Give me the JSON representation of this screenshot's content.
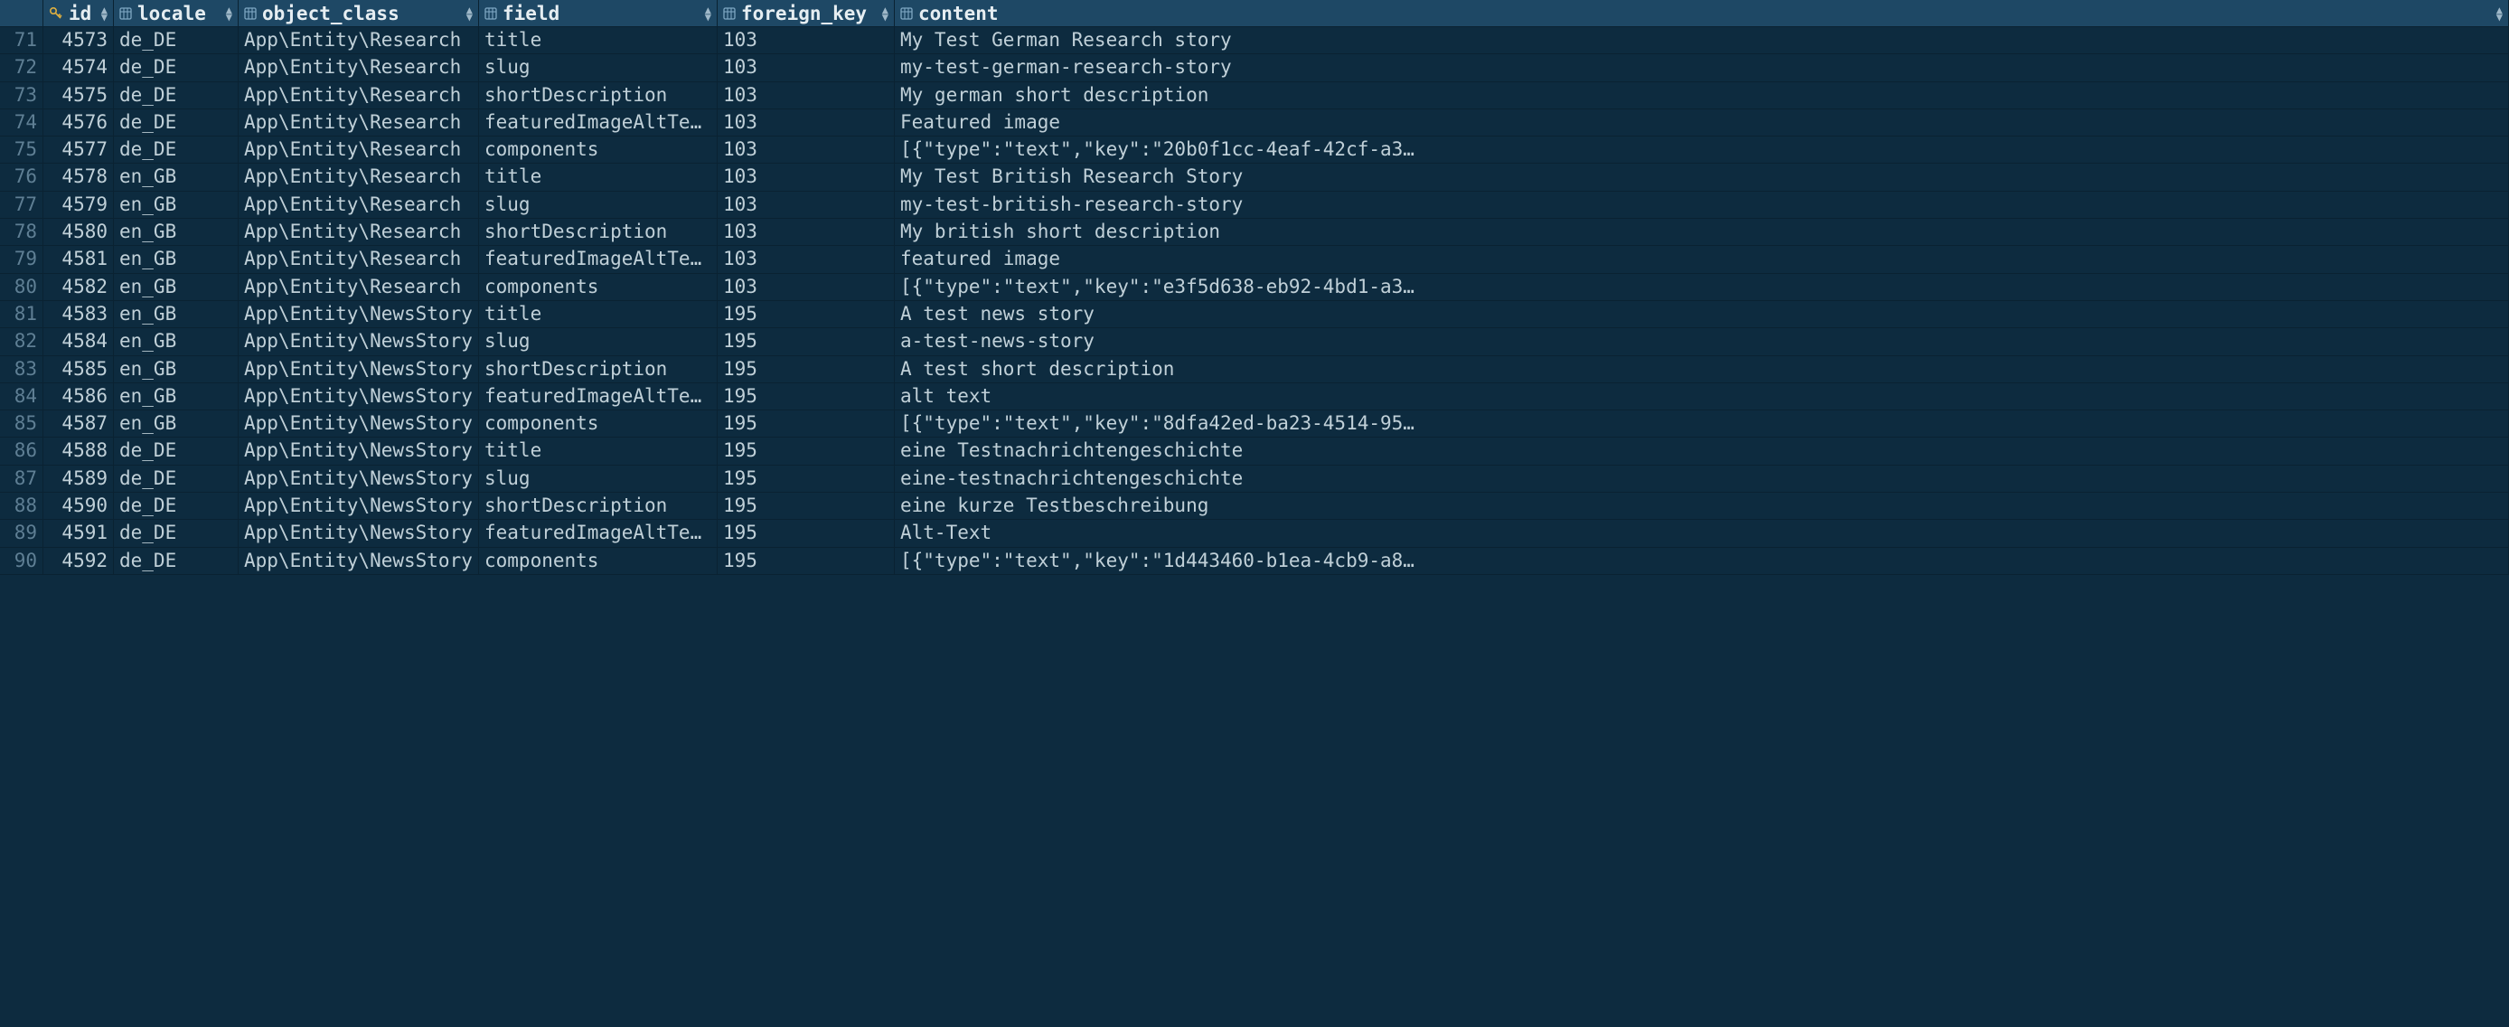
{
  "columns": [
    {
      "name": "id",
      "type": "pk"
    },
    {
      "name": "locale",
      "type": "col"
    },
    {
      "name": "object_class",
      "type": "col"
    },
    {
      "name": "field",
      "type": "col"
    },
    {
      "name": "foreign_key",
      "type": "col"
    },
    {
      "name": "content",
      "type": "col"
    }
  ],
  "rows": [
    {
      "n": 71,
      "id": 4573,
      "locale": "de_DE",
      "object_class": "App\\Entity\\Research",
      "field": "title",
      "foreign_key": 103,
      "content": "My Test German Research story"
    },
    {
      "n": 72,
      "id": 4574,
      "locale": "de_DE",
      "object_class": "App\\Entity\\Research",
      "field": "slug",
      "foreign_key": 103,
      "content": "my-test-german-research-story"
    },
    {
      "n": 73,
      "id": 4575,
      "locale": "de_DE",
      "object_class": "App\\Entity\\Research",
      "field": "shortDescription",
      "foreign_key": 103,
      "content": "My german short description"
    },
    {
      "n": 74,
      "id": 4576,
      "locale": "de_DE",
      "object_class": "App\\Entity\\Research",
      "field": "featuredImageAltText",
      "foreign_key": 103,
      "content": "Featured image"
    },
    {
      "n": 75,
      "id": 4577,
      "locale": "de_DE",
      "object_class": "App\\Entity\\Research",
      "field": "components",
      "foreign_key": 103,
      "content": "[{\"type\":\"text\",\"key\":\"20b0f1cc-4eaf-42cf-a3…"
    },
    {
      "n": 76,
      "id": 4578,
      "locale": "en_GB",
      "object_class": "App\\Entity\\Research",
      "field": "title",
      "foreign_key": 103,
      "content": "My Test British Research Story"
    },
    {
      "n": 77,
      "id": 4579,
      "locale": "en_GB",
      "object_class": "App\\Entity\\Research",
      "field": "slug",
      "foreign_key": 103,
      "content": "my-test-british-research-story"
    },
    {
      "n": 78,
      "id": 4580,
      "locale": "en_GB",
      "object_class": "App\\Entity\\Research",
      "field": "shortDescription",
      "foreign_key": 103,
      "content": "My british short description"
    },
    {
      "n": 79,
      "id": 4581,
      "locale": "en_GB",
      "object_class": "App\\Entity\\Research",
      "field": "featuredImageAltText",
      "foreign_key": 103,
      "content": "featured image"
    },
    {
      "n": 80,
      "id": 4582,
      "locale": "en_GB",
      "object_class": "App\\Entity\\Research",
      "field": "components",
      "foreign_key": 103,
      "content": "[{\"type\":\"text\",\"key\":\"e3f5d638-eb92-4bd1-a3…"
    },
    {
      "n": 81,
      "id": 4583,
      "locale": "en_GB",
      "object_class": "App\\Entity\\NewsStory",
      "field": "title",
      "foreign_key": 195,
      "content": "A test news story"
    },
    {
      "n": 82,
      "id": 4584,
      "locale": "en_GB",
      "object_class": "App\\Entity\\NewsStory",
      "field": "slug",
      "foreign_key": 195,
      "content": "a-test-news-story"
    },
    {
      "n": 83,
      "id": 4585,
      "locale": "en_GB",
      "object_class": "App\\Entity\\NewsStory",
      "field": "shortDescription",
      "foreign_key": 195,
      "content": "A test short description"
    },
    {
      "n": 84,
      "id": 4586,
      "locale": "en_GB",
      "object_class": "App\\Entity\\NewsStory",
      "field": "featuredImageAltText",
      "foreign_key": 195,
      "content": "alt text"
    },
    {
      "n": 85,
      "id": 4587,
      "locale": "en_GB",
      "object_class": "App\\Entity\\NewsStory",
      "field": "components",
      "foreign_key": 195,
      "content": "[{\"type\":\"text\",\"key\":\"8dfa42ed-ba23-4514-95…"
    },
    {
      "n": 86,
      "id": 4588,
      "locale": "de_DE",
      "object_class": "App\\Entity\\NewsStory",
      "field": "title",
      "foreign_key": 195,
      "content": "eine Testnachrichtengeschichte"
    },
    {
      "n": 87,
      "id": 4589,
      "locale": "de_DE",
      "object_class": "App\\Entity\\NewsStory",
      "field": "slug",
      "foreign_key": 195,
      "content": "eine-testnachrichtengeschichte"
    },
    {
      "n": 88,
      "id": 4590,
      "locale": "de_DE",
      "object_class": "App\\Entity\\NewsStory",
      "field": "shortDescription",
      "foreign_key": 195,
      "content": "eine kurze Testbeschreibung"
    },
    {
      "n": 89,
      "id": 4591,
      "locale": "de_DE",
      "object_class": "App\\Entity\\NewsStory",
      "field": "featuredImageAltText",
      "foreign_key": 195,
      "content": "Alt-Text"
    },
    {
      "n": 90,
      "id": 4592,
      "locale": "de_DE",
      "object_class": "App\\Entity\\NewsStory",
      "field": "components",
      "foreign_key": 195,
      "content": "[{\"type\":\"text\",\"key\":\"1d443460-b1ea-4cb9-a8…"
    }
  ]
}
